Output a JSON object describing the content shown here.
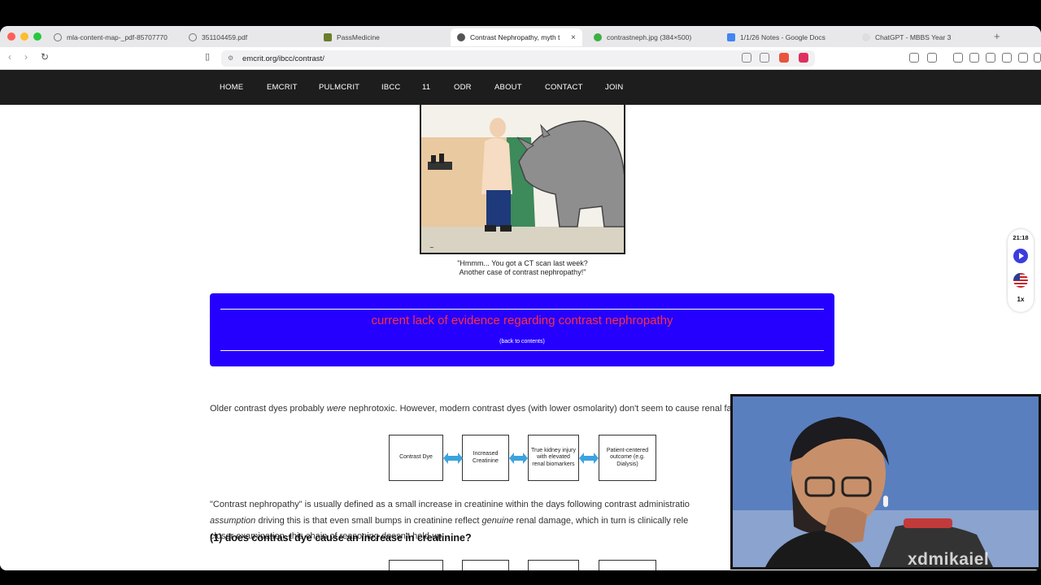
{
  "browser": {
    "tabs": [
      {
        "title": "mla-content-map-_pdf-85707770",
        "icon_color": "#888888"
      },
      {
        "title": "351104459.pdf",
        "icon_color": "#888888"
      },
      {
        "title": "PassMedicine",
        "icon_color": "#6b7d2a"
      },
      {
        "title": "Contrast Nephropathy, myth t",
        "icon_color": "#555555",
        "active": true
      },
      {
        "title": "contrastneph.jpg (384×500)",
        "icon_color": "#3cb043"
      },
      {
        "title": "1/1/26 Notes - Google Docs",
        "icon_color": "#4285f4"
      },
      {
        "title": "ChatGPT - MBBS Year 3",
        "icon_color": "#dddddd"
      }
    ],
    "new_tab": "+",
    "url": "emcrit.org/ibcc/contrast/"
  },
  "site_nav": {
    "items": [
      "HOME",
      "EMCRIT",
      "PULMCRIT",
      "IBCC",
      "11",
      "ODR",
      "ABOUT",
      "CONTACT",
      "JOIN"
    ]
  },
  "cartoon": {
    "caption_line1": "\"Hmmm... You got a CT scan last week?",
    "caption_line2": "Another case of contrast nephropathy!\""
  },
  "banner": {
    "title": "current lack of evidence regarding contrast nephropathy",
    "back_link": "(back to contents)"
  },
  "intro": {
    "part1": "Older contrast dyes probably ",
    "emph": "were",
    "part2": " nephrotoxic. However, modern contrast dyes (with lower osmolarity) don't seem to cause renal failure."
  },
  "flow": {
    "boxes": [
      "Contrast Dye",
      "Increased Creatinine",
      "True kidney injury with elevated renal biomarkers",
      "Patient-centered outcome (e.g. Dialysis)"
    ]
  },
  "body": {
    "line1": "\"Contrast nephropathy\" is usually defined as a small increase in creatinine within the days following contrast administratio",
    "line2_em1": "assumption",
    "line2_mid": " driving this is that even small bumps in creatinine reflect ",
    "line2_em2": "genuine",
    "line2_end": " renal damage, which in turn is clinically rele",
    "line3": "closer examination, this chain of reasoning doesn't hold up..."
  },
  "section_heading": "(1) does contrast dye cause an increase in creatinine?",
  "player": {
    "time": "21:18",
    "speed": "1x"
  },
  "watermark": "xdmikaiel",
  "colors": {
    "banner_bg": "#2600ff",
    "banner_title": "#ff2d40",
    "arrow": "#3ba3e0",
    "nav_bg": "#1d1d1d"
  }
}
